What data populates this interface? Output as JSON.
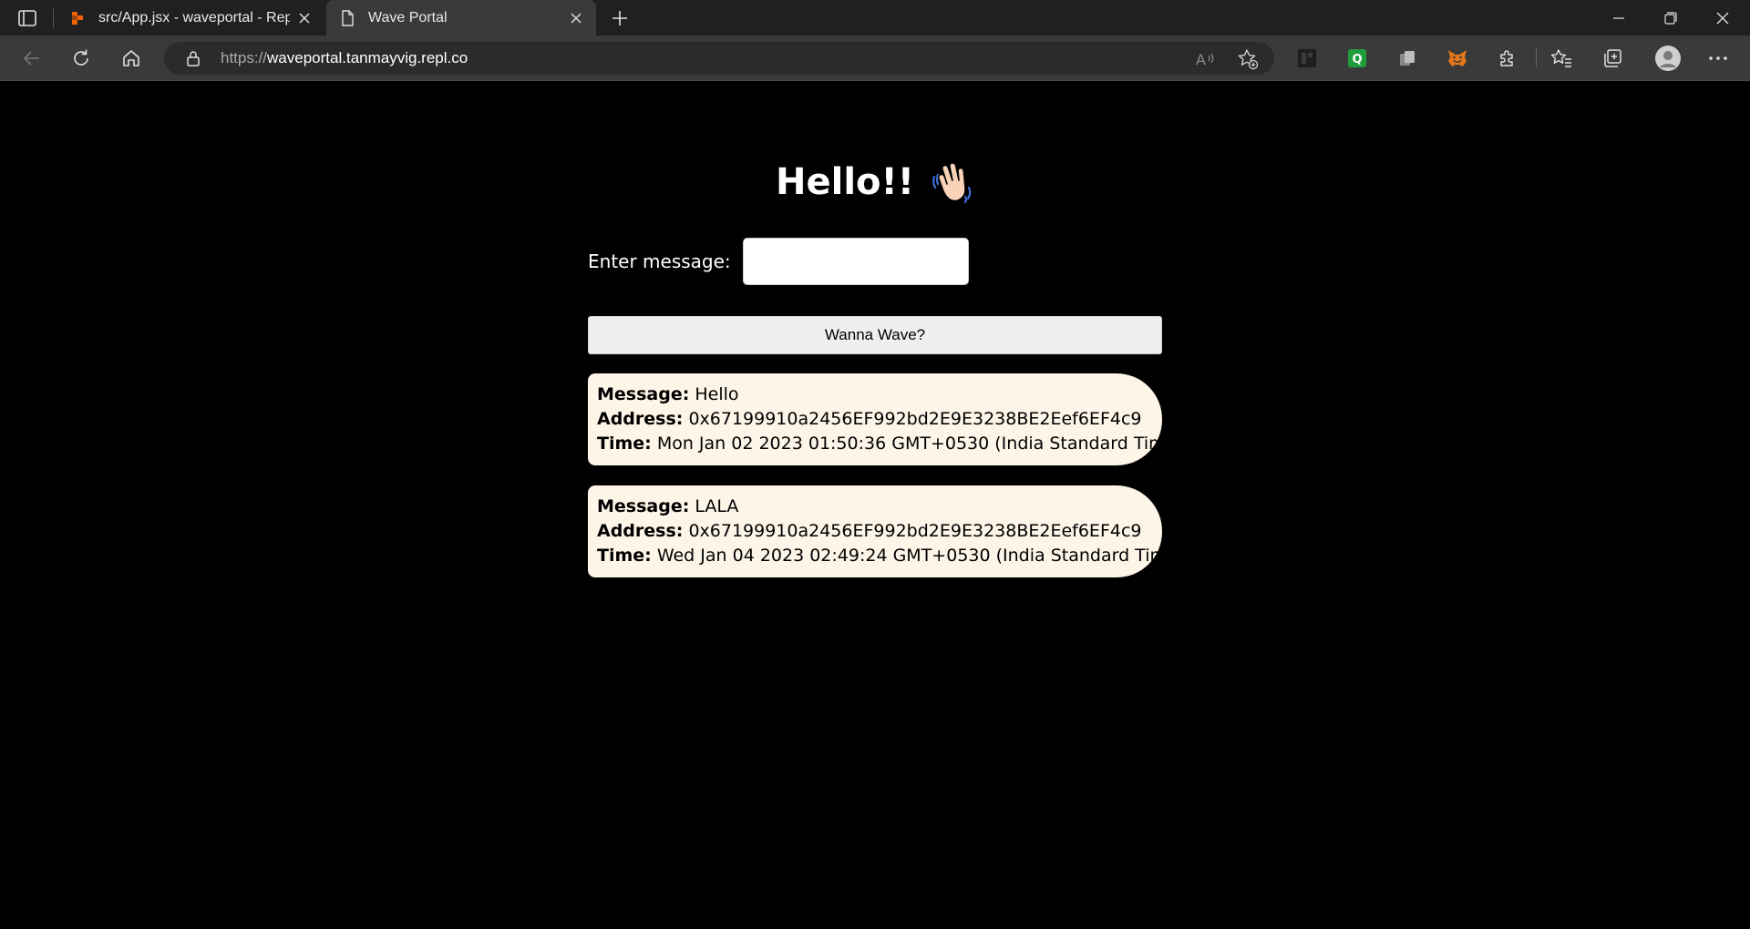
{
  "browser": {
    "tabs": [
      {
        "title": "src/App.jsx - waveportal - Replit",
        "favicon": "replit-icon",
        "active": false
      },
      {
        "title": "Wave Portal",
        "favicon": "page-icon",
        "active": true
      }
    ],
    "url_scheme": "https://",
    "url_host": "waveportal.tanmayvig.repl.co"
  },
  "page": {
    "heading": "Hello!!",
    "input_label": "Enter message:",
    "input_value": "",
    "wave_button_label": "Wanna Wave?",
    "waves": [
      {
        "message_label": "Message:",
        "message": "Hello",
        "address_label": "Address:",
        "address": "0x67199910a2456EF992bd2E9E3238BE2Eef6EF4c9",
        "time_label": "Time:",
        "time": "Mon Jan 02 2023 01:50:36 GMT+0530 (India Standard Time)"
      },
      {
        "message_label": "Message:",
        "message": "LALA",
        "address_label": "Address:",
        "address": "0x67199910a2456EF992bd2E9E3238BE2Eef6EF4c9",
        "time_label": "Time:",
        "time": "Wed Jan 04 2023 02:49:24 GMT+0530 (India Standard Time)"
      }
    ]
  },
  "colors": {
    "page_background": "#000000",
    "card_background": "#fdf5e8",
    "chrome_dark": "#202020",
    "chrome_toolbar": "#3a3a3a"
  }
}
